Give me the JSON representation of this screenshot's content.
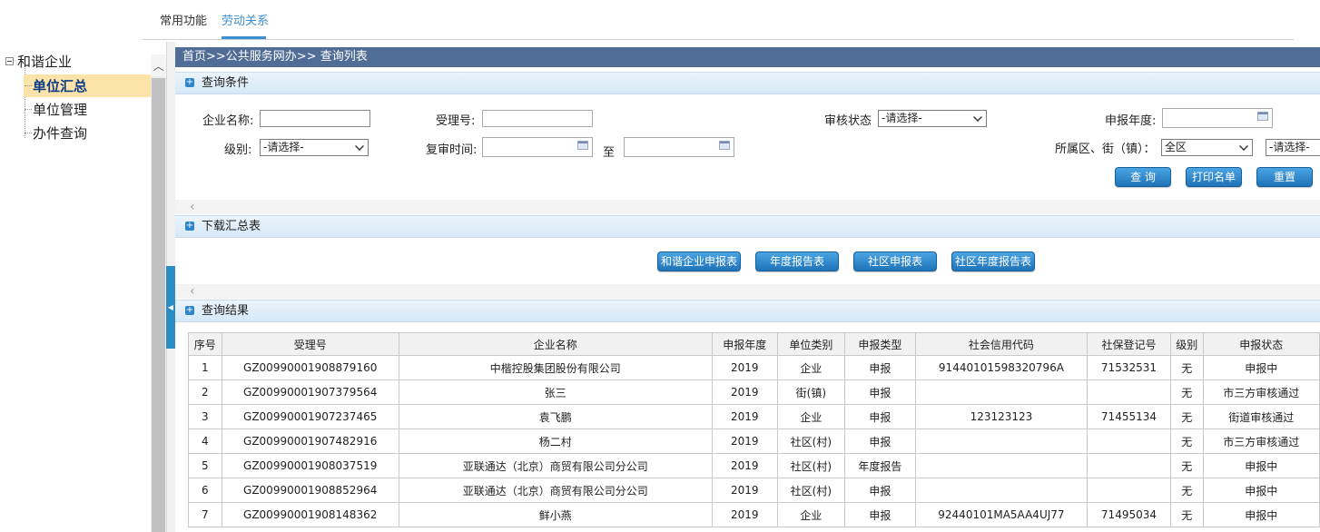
{
  "topbar": {
    "tabs": [
      {
        "label": "常用功能",
        "active": false
      },
      {
        "label": "劳动关系",
        "active": true
      }
    ]
  },
  "tree": {
    "root": "和谐企业",
    "children": [
      "单位汇总",
      "单位管理",
      "办件查询"
    ],
    "selected": "单位汇总"
  },
  "breadcrumb": "首页>>公共服务网办>> 查询列表",
  "query": {
    "section_title": "查询条件",
    "enterprise_name_label": "企业名称:",
    "enterprise_name_value": "",
    "accept_no_label": "受理号:",
    "accept_no_value": "",
    "audit_status_label": "审核状态",
    "audit_status_value": "-请选择-",
    "report_year_label": "申报年度:",
    "report_year_value": "",
    "level_label": "级别:",
    "level_value": "-请选择-",
    "review_time_label": "复审时间:",
    "review_from": "",
    "to_label": "至",
    "review_to": "",
    "district_label": "所属区、街（镇）：",
    "district_value": "全区",
    "street_value": "-请选择-",
    "buttons": {
      "query": "查 询",
      "print": "打印名单",
      "reset": "重置"
    }
  },
  "download": {
    "section_title": "下载汇总表",
    "buttons": [
      "和谐企业申报表",
      "年度报告表",
      "社区申报表",
      "社区年度报告表"
    ]
  },
  "results": {
    "section_title": "查询结果",
    "columns": [
      "序号",
      "受理号",
      "企业名称",
      "申报年度",
      "单位类别",
      "申报类型",
      "社会信用代码",
      "社保登记号",
      "级别",
      "申报状态"
    ],
    "rows": [
      [
        "1",
        "GZ00990001908879160",
        "中楷控股集团股份有限公司",
        "2019",
        "企业",
        "申报",
        "91440101598320796A",
        "71532531",
        "无",
        "申报中"
      ],
      [
        "2",
        "GZ00990001907379564",
        "张三",
        "2019",
        "街(镇)",
        "申报",
        "",
        "",
        "无",
        "市三方审核通过"
      ],
      [
        "3",
        "GZ00990001907237465",
        "袁飞鹏",
        "2019",
        "企业",
        "申报",
        "123123123",
        "71455134",
        "无",
        "街道审核通过"
      ],
      [
        "4",
        "GZ00990001907482916",
        "杨二村",
        "2019",
        "社区(村)",
        "申报",
        "",
        "",
        "无",
        "市三方审核通过"
      ],
      [
        "5",
        "GZ00990001908037519",
        "亚联通达（北京）商贸有限公司分公司",
        "2019",
        "社区(村)",
        "年度报告",
        "",
        "",
        "无",
        "申报中"
      ],
      [
        "6",
        "GZ00990001908852964",
        "亚联通达（北京）商贸有限公司分公司",
        "2019",
        "社区(村)",
        "申报",
        "",
        "",
        "无",
        "申报中"
      ],
      [
        "7",
        "GZ00990001908148362",
        "鲜小燕",
        "2019",
        "企业",
        "申报",
        "92440101MA5AA4UJ77",
        "71495034",
        "无",
        "申报中"
      ]
    ]
  }
}
